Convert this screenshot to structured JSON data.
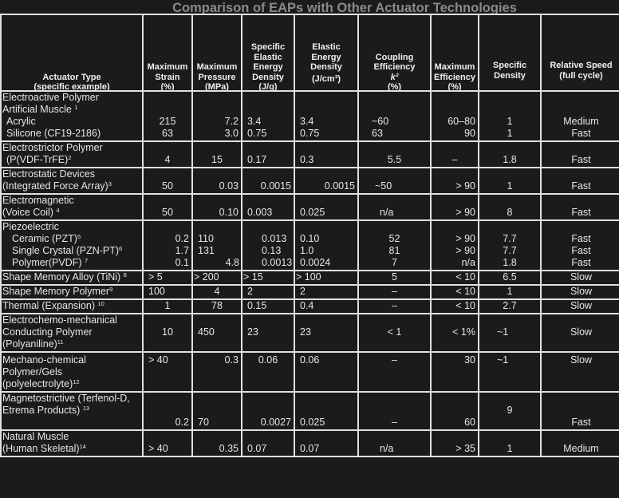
{
  "title": "Comparison of EAPs with Other Actuator Technologies",
  "headers": [
    {
      "lines": [
        "Actuator Type",
        "(specific example)"
      ]
    },
    {
      "lines": [
        "Maximum",
        "Strain",
        "(%)"
      ]
    },
    {
      "lines": [
        "Maximum",
        "Pressure",
        "(MPa)"
      ]
    },
    {
      "lines": [
        "Specific",
        "Elastic",
        "Energy",
        "Density",
        "(J/g)"
      ]
    },
    {
      "lines": [
        "Elastic",
        "Energy",
        "Density",
        "(J/cm³)"
      ]
    },
    {
      "lines": [
        "Coupling",
        "Efficiency",
        "k²",
        "(%)"
      ]
    },
    {
      "lines": [
        "Maximum",
        "Efficiency",
        "(%)"
      ]
    },
    {
      "lines": [
        "Specific",
        "Density"
      ]
    },
    {
      "lines": [
        "Relative Speed",
        "(full cycle)"
      ]
    }
  ],
  "rows": [
    {
      "group": "Electroactive Polymer",
      "group2": "Artificial Muscle",
      "ref": "1",
      "items": [
        {
          "name": "Acrylic",
          "ref": "",
          "strain": "215",
          "pressure": "7.2",
          "sed": "3.4",
          "ed": "3.4",
          "coupling": "~60",
          "maxeff": "60–80",
          "density": "1",
          "speed": "Medium"
        },
        {
          "name": "Silicone (CF19-2186)",
          "ref": "",
          "strain": "63",
          "pressure": "3.0",
          "sed": "0.75",
          "ed": "0.75",
          "coupling": "63",
          "maxeff": "90",
          "density": "1",
          "speed": "Fast"
        }
      ]
    },
    {
      "group": "Electrostrictor Polymer",
      "name": "(P(VDF-TrFE)",
      "ref": "2",
      "strain": "4",
      "pressure": "15",
      "sed": "0.17",
      "ed": "0.3",
      "coupling": "5.5",
      "maxeff": "–",
      "density": "1.8",
      "speed": "Fast"
    },
    {
      "group": "Electrostatic Devices",
      "name": "(Integrated Force Array)",
      "ref": "3",
      "strain": "50",
      "pressure": "0.03",
      "sed": "0.0015",
      "ed": "0.0015",
      "coupling": "~50",
      "maxeff": "> 90",
      "density": "1",
      "speed": "Fast"
    },
    {
      "group": "Electromagnetic",
      "name": "(Voice Coil)",
      "ref": "4",
      "strain": "50",
      "pressure": "0.10",
      "sed": "0.003",
      "ed": "0.025",
      "coupling": "n/a",
      "maxeff": "> 90",
      "density": "8",
      "speed": "Fast"
    },
    {
      "group": "Piezoelectric",
      "items": [
        {
          "name": "Ceramic (PZT)",
          "ref": "5",
          "strain": "0.2",
          "pressure": "110",
          "sed": "0.013",
          "ed": "0.10",
          "coupling": "52",
          "maxeff": "> 90",
          "density": "7.7",
          "speed": "Fast"
        },
        {
          "name": "Single Crystal (PZN-PT)",
          "ref": "6",
          "strain": "1.7",
          "pressure": "131",
          "sed": "0.13",
          "ed": "1.0",
          "coupling": "81",
          "maxeff": "> 90",
          "density": "7.7",
          "speed": "Fast"
        },
        {
          "name": "Polymer(PVDF)",
          "ref": "7",
          "strain": "0.1",
          "pressure": "4.8",
          "sed": "0.0013",
          "ed": "0.0024",
          "coupling": "7",
          "maxeff": "n/a",
          "density": "1.8",
          "speed": "Fast"
        }
      ]
    },
    {
      "name": "Shape Memory Alloy (TiNi)",
      "ref": "8",
      "strain": "> 5",
      "pressure": "> 200",
      "sed": "> 15",
      "ed": "> 100",
      "coupling": "5",
      "maxeff": "< 10",
      "density": "6.5",
      "speed": "Slow"
    },
    {
      "name": "Shape Memory Polymer",
      "ref": "9",
      "strain": "100",
      "pressure": "4",
      "sed": "2",
      "ed": "2",
      "coupling": "–",
      "maxeff": "< 10",
      "density": "1",
      "speed": "Slow"
    },
    {
      "name": "Thermal (Expansion)",
      "ref": "10",
      "strain": "1",
      "pressure": "78",
      "sed": "0.15",
      "ed": "0.4",
      "coupling": "–",
      "maxeff": "< 10",
      "density": "2.7",
      "speed": "Slow"
    },
    {
      "lines": [
        "Electrochemo-mechanical",
        "Conducting Polymer",
        "(Polyaniline)"
      ],
      "ref": "11",
      "strain": "10",
      "pressure": "450",
      "sed": "23",
      "ed": "23",
      "coupling": "< 1",
      "maxeff": "< 1%",
      "density": "~1",
      "speed": "Slow"
    },
    {
      "lines": [
        "Mechano-chemical",
        "Polymer/Gels",
        "(polyelectrolyte)"
      ],
      "ref": "12",
      "strain": "> 40",
      "pressure": "0.3",
      "sed": "0.06",
      "ed": "0.06",
      "coupling": "–",
      "maxeff": "30",
      "density": "~1",
      "speed": "Slow"
    },
    {
      "lines": [
        "Magnetostrictive (Terfenol-D,",
        "Etrema Products)"
      ],
      "ref": "13",
      "strain": "0.2",
      "pressure": "70",
      "sed": "0.0027",
      "ed": "0.025",
      "coupling": "–",
      "maxeff": "60",
      "density": "9",
      "speed": "Fast"
    },
    {
      "lines": [
        "Natural Muscle",
        "(Human Skeletal)"
      ],
      "ref": "14",
      "strain": "> 40",
      "pressure": "0.35",
      "sed": "0.07",
      "ed": "0.07",
      "coupling": "n/a",
      "maxeff": "> 35",
      "density": "1",
      "speed": "Medium"
    }
  ]
}
